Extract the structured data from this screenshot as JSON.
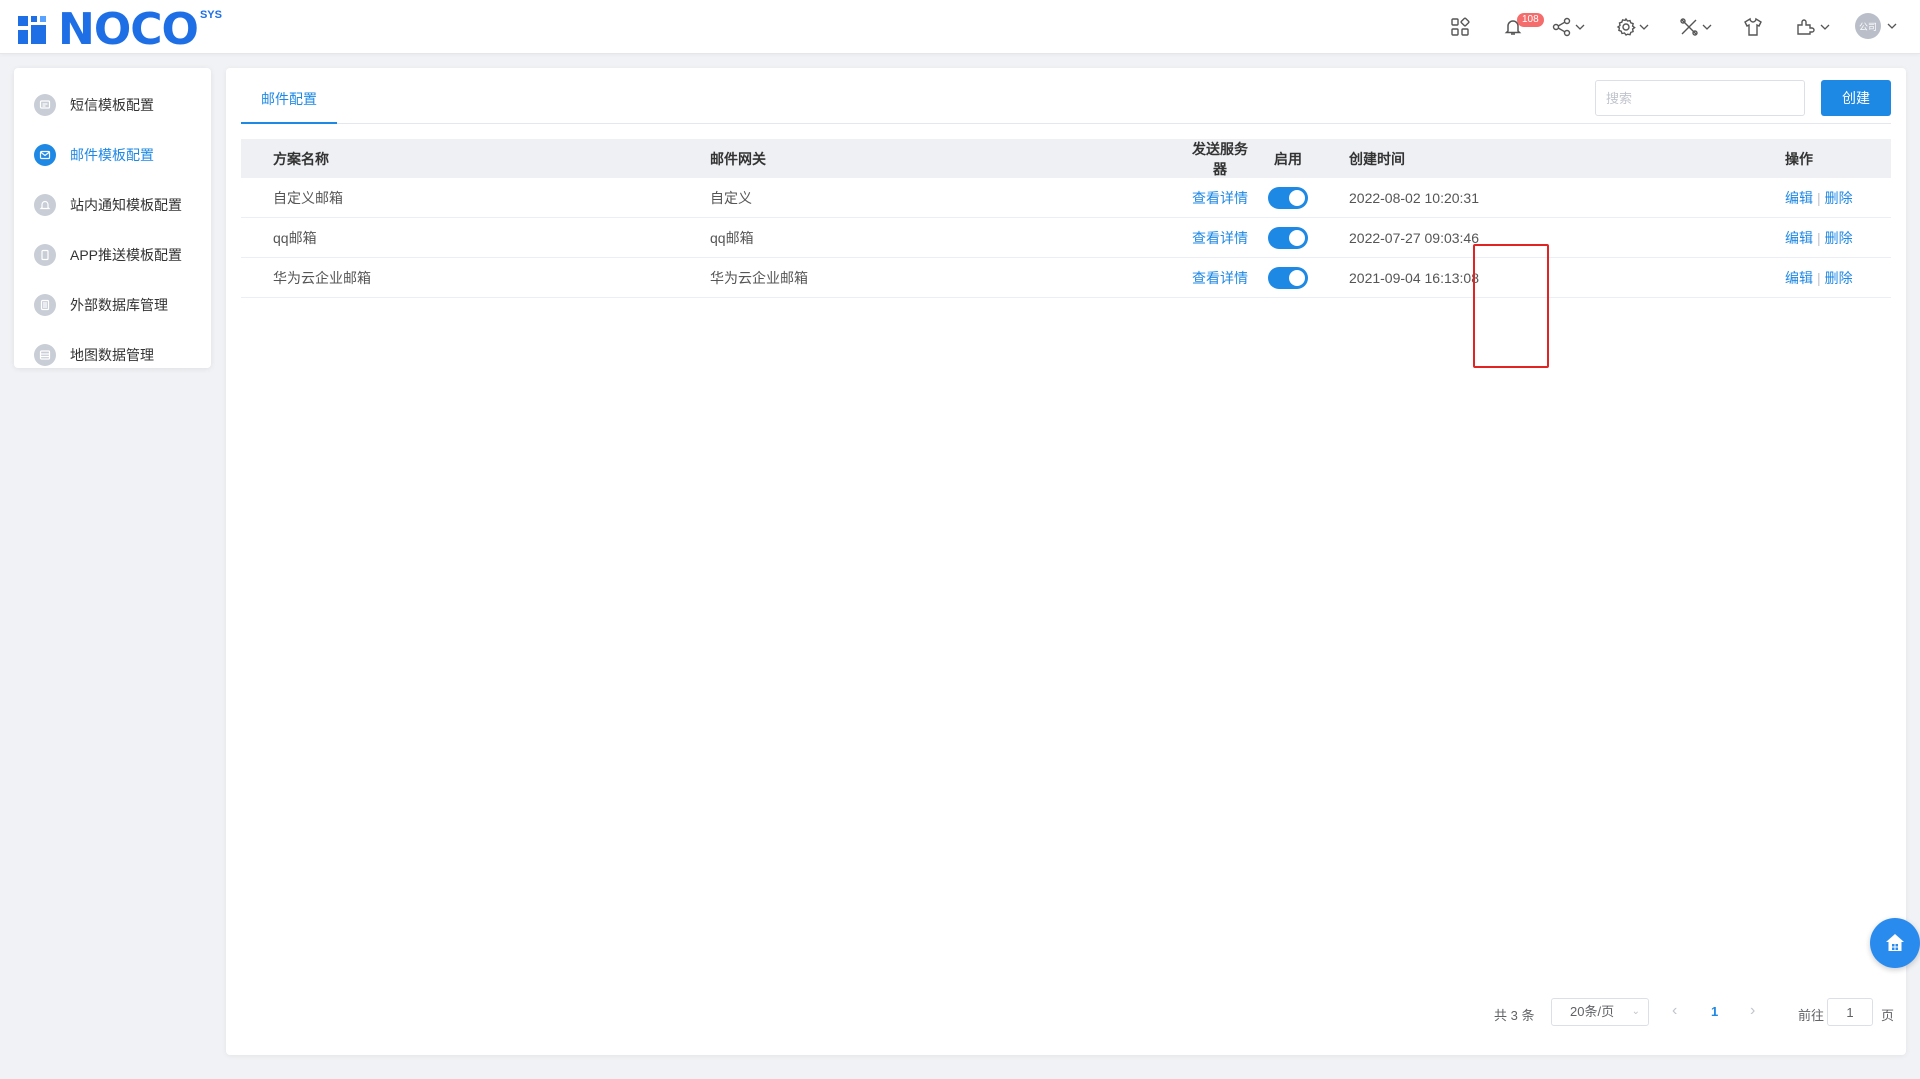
{
  "brand": {
    "logo_text": "NOCO",
    "logo_sup": "SYS",
    "primary_color": "#1e88e5"
  },
  "topbar": {
    "notification_count": "108",
    "avatar_text": "公司",
    "icons": [
      "apps-grid-icon",
      "bell-icon",
      "share-icon",
      "gear-icon",
      "tools-icon",
      "shirt-icon",
      "puzzle-icon"
    ]
  },
  "sidebar": {
    "items": [
      {
        "label": "短信模板配置",
        "icon": "message-icon",
        "active": false
      },
      {
        "label": "邮件模板配置",
        "icon": "mail-icon",
        "active": true
      },
      {
        "label": "站内通知模板配置",
        "icon": "bell-icon",
        "active": false
      },
      {
        "label": "APP推送模板配置",
        "icon": "phone-icon",
        "active": false
      },
      {
        "label": "外部数据库管理",
        "icon": "database-icon",
        "active": false
      },
      {
        "label": "地图数据管理",
        "icon": "map-icon",
        "active": false
      }
    ]
  },
  "main": {
    "tab_label": "邮件配置",
    "search_placeholder": "搜索",
    "create_label": "创建",
    "table": {
      "headers": [
        "方案名称",
        "邮件网关",
        "发送服务器",
        "启用",
        "创建时间",
        "操作"
      ],
      "rows": [
        {
          "name": "自定义邮箱",
          "gateway": "自定义",
          "server_link": "查看详情",
          "enabled": true,
          "created": "2022-08-02 10:20:31",
          "edit": "编辑",
          "delete": "删除"
        },
        {
          "name": "qq邮箱",
          "gateway": "qq邮箱",
          "server_link": "查看详情",
          "enabled": true,
          "created": "2022-07-27 09:03:46",
          "edit": "编辑",
          "delete": "删除"
        },
        {
          "name": "华为云企业邮箱",
          "gateway": "华为云企业邮箱",
          "server_link": "查看详情",
          "enabled": true,
          "created": "2021-09-04 16:13:08",
          "edit": "编辑",
          "delete": "删除"
        }
      ]
    },
    "pagination": {
      "total": "共 3 条",
      "page_size": "20条/页",
      "current_page": "1",
      "goto_label": "前往",
      "goto_value": "1",
      "page_suffix": "页"
    }
  }
}
